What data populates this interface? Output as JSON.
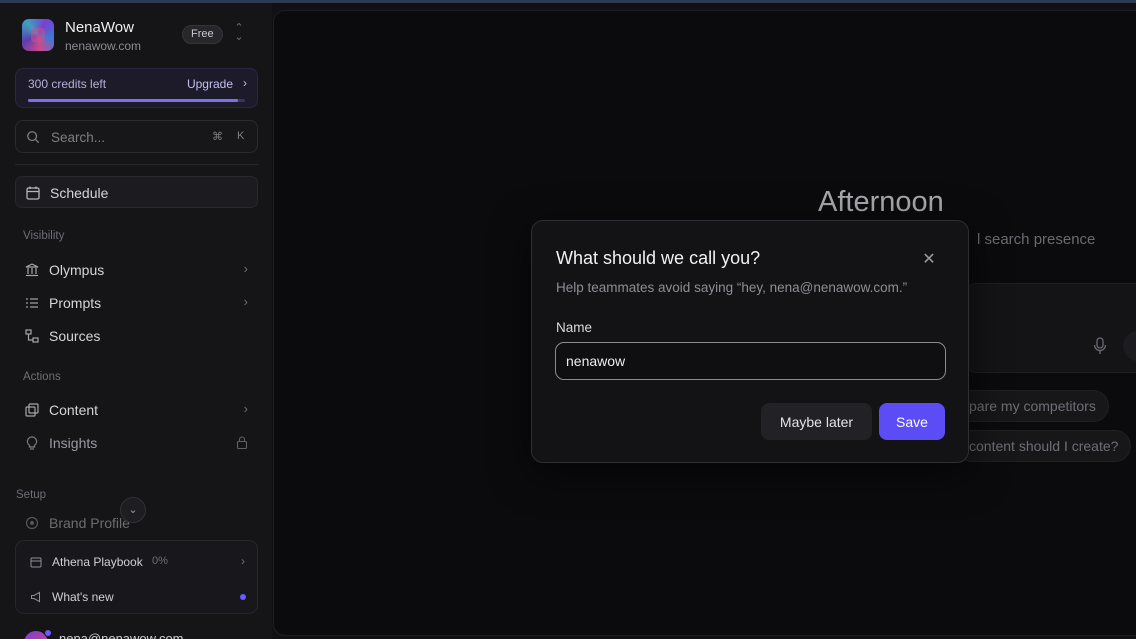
{
  "workspace": {
    "name": "NenaWow",
    "domain": "nenawow.com",
    "plan_badge": "Free"
  },
  "credits": {
    "label": "300 credits left",
    "upgrade_label": "Upgrade",
    "fill_fraction": 0.97
  },
  "search": {
    "placeholder": "Search...",
    "shortcut_cmd": "⌘",
    "shortcut_key": "K"
  },
  "nav": {
    "schedule": "Schedule",
    "visibility_section": "Visibility",
    "olympus": "Olympus",
    "prompts": "Prompts",
    "sources": "Sources",
    "actions_section": "Actions",
    "content": "Content",
    "insights": "Insights",
    "setup_section": "Setup",
    "brand_profile": "Brand Profile"
  },
  "bottom_card": {
    "playbook_label": "Athena Playbook",
    "playbook_progress": "0%",
    "whats_new": "What's new"
  },
  "user": {
    "email": "nena@nenawow.com"
  },
  "main": {
    "greeting": "Afternoon",
    "subtitle_fragment": "l search presence",
    "chip_1": "pare my competitors",
    "chip_2": "content should I create?"
  },
  "modal": {
    "title": "What should we call you?",
    "subtitle": "Help teammates avoid saying “hey, nena@nenawow.com.”",
    "name_label": "Name",
    "name_value": "nenawow",
    "later_label": "Maybe later",
    "save_label": "Save"
  },
  "colors": {
    "accent": "#5b4cf5",
    "background": "#0b0b0d",
    "sidebar": "#151518"
  }
}
